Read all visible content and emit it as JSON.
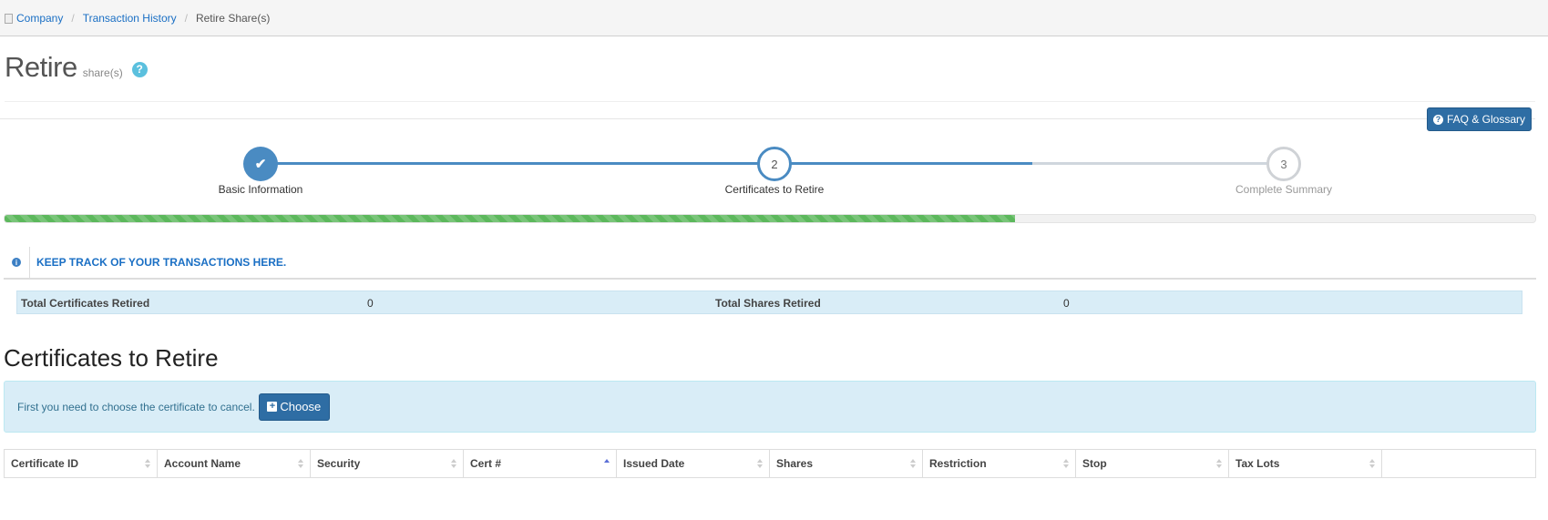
{
  "breadcrumb": {
    "items": [
      {
        "label": "Company",
        "icon": "document-icon"
      },
      {
        "label": "Transaction History"
      },
      {
        "label": "Retire Share(s)"
      }
    ]
  },
  "page": {
    "title": "Retire",
    "subtitle": "share(s)",
    "help_glyph": "?"
  },
  "faq_button": {
    "label": "FAQ & Glossary",
    "icon_glyph": "?"
  },
  "wizard": {
    "steps": [
      {
        "number": "1",
        "label": "Basic Information",
        "state": "complete",
        "glyph": "✔"
      },
      {
        "number": "2",
        "label": "Certificates to Retire",
        "state": "active"
      },
      {
        "number": "3",
        "label": "Complete Summary",
        "state": "pending"
      }
    ],
    "progress_percent": 66
  },
  "info_banner": {
    "icon_glyph": "i",
    "message": "KEEP TRACK OF YOUR TRANSACTIONS HERE."
  },
  "totals": {
    "certificates_label": "Total Certificates Retired",
    "certificates_value": "0",
    "shares_label": "Total Shares Retired",
    "shares_value": "0"
  },
  "section": {
    "title": "Certificates to Retire"
  },
  "alert": {
    "text": "First you need to choose the certificate to cancel.",
    "button_label": "Choose",
    "button_glyph": "+"
  },
  "table": {
    "columns": [
      {
        "label": "Certificate ID",
        "sort": "none"
      },
      {
        "label": "Account Name",
        "sort": "none"
      },
      {
        "label": "Security",
        "sort": "none"
      },
      {
        "label": "Cert #",
        "sort": "asc"
      },
      {
        "label": "Issued Date",
        "sort": "none"
      },
      {
        "label": "Shares",
        "sort": "none"
      },
      {
        "label": "Restriction",
        "sort": "none"
      },
      {
        "label": "Stop",
        "sort": "none"
      },
      {
        "label": "Tax Lots",
        "sort": "none"
      },
      {
        "label": "",
        "sort": "none"
      }
    ]
  },
  "colors": {
    "primary": "#2e6da4",
    "step_active": "#4a8bc2",
    "progress": "#5cb85c",
    "info_bg": "#d9edf7"
  }
}
